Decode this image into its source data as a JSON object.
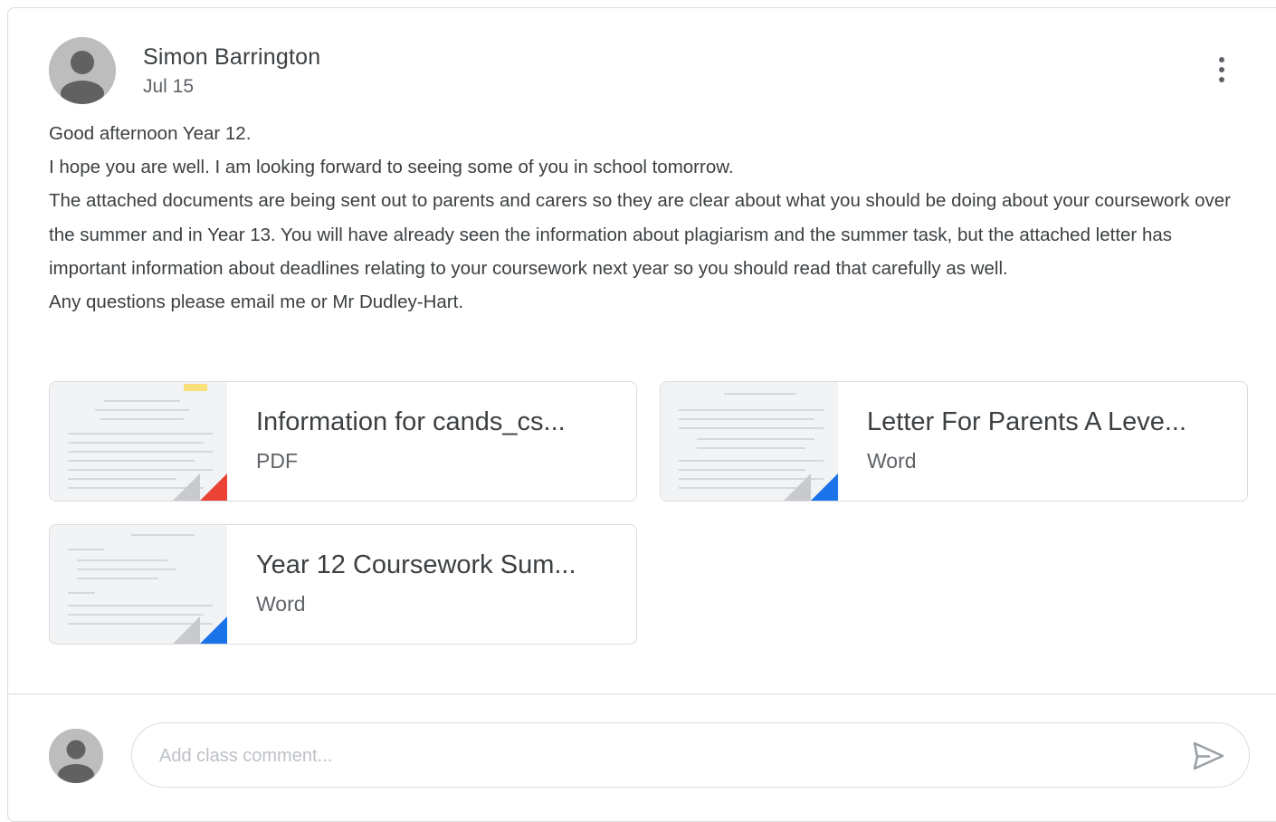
{
  "post": {
    "author": "Simon Barrington",
    "date": "Jul 15",
    "body": [
      "Good afternoon Year 12.",
      "I hope you are well. I am looking forward to seeing some of you in school tomorrow.",
      "The attached documents are being sent out to parents and carers so they are clear about what you should be doing about your coursework over the summer and in Year 13. You will have already seen the information about plagiarism and the summer task, but the attached letter has important information about deadlines relating to your coursework next year so you should read that carefully as well.",
      "Any questions please email me or Mr Dudley-Hart."
    ]
  },
  "attachments": [
    {
      "title": "Information for cands_cs...",
      "type": "PDF",
      "accent": "#ea4335"
    },
    {
      "title": "Letter For Parents A Leve...",
      "type": "Word",
      "accent": "#1a73e8"
    },
    {
      "title": "Year 12 Coursework Sum...",
      "type": "Word",
      "accent": "#1a73e8"
    }
  ],
  "comment": {
    "placeholder": "Add class comment..."
  },
  "icons": {
    "avatar": "person-icon",
    "more": "more-vertical-icon",
    "send": "send-icon"
  },
  "colors": {
    "border": "#dadce0",
    "text": "#3c4043",
    "secondary_text": "#5f6368",
    "avatar_bg": "#bdbdbd"
  }
}
